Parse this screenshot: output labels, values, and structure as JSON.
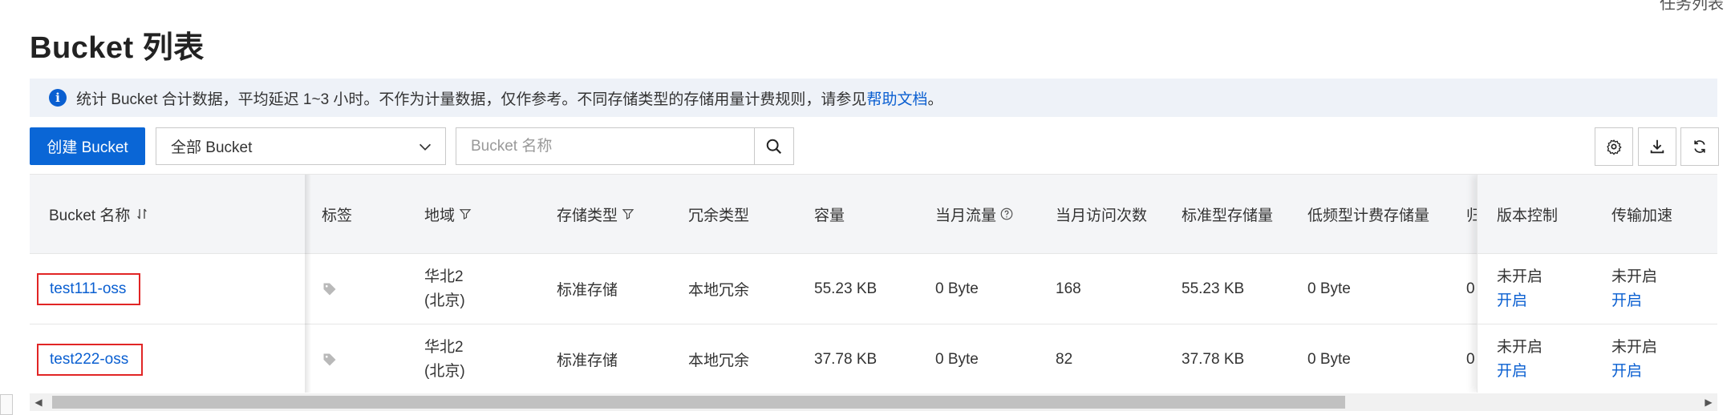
{
  "page": {
    "topright_text": "任务列表",
    "title": "Bucket 列表"
  },
  "notice": {
    "text": "统计 Bucket 合计数据，平均延迟 1~3 小时。不作为计量数据，仅作参考。不同存储类型的存储用量计费规则，请参见",
    "link_text": "帮助文档",
    "suffix": "。"
  },
  "toolbar": {
    "create_label": "创建 Bucket",
    "filter_value": "全部 Bucket",
    "search_placeholder": "Bucket 名称",
    "icons": [
      "gear-icon",
      "download-icon",
      "refresh-icon"
    ]
  },
  "table": {
    "headers": {
      "name": "Bucket 名称",
      "tag": "标签",
      "region": "地域",
      "storage_class": "存储类型",
      "redundancy": "冗余类型",
      "capacity": "容量",
      "monthly_traffic": "当月流量",
      "monthly_requests": "当月访问次数",
      "standard_storage": "标准型存储量",
      "ia_storage": "低频型计费存储量",
      "archive_partial": "归",
      "versioning": "版本控制",
      "acceleration": "传输加速"
    },
    "rows": [
      {
        "name": "test111-oss",
        "region_line1": "华北2",
        "region_line2": "(北京)",
        "storage_class": "标准存储",
        "redundancy": "本地冗余",
        "capacity": "55.23 KB",
        "monthly_traffic": "0 Byte",
        "monthly_requests": "168",
        "standard_storage": "55.23 KB",
        "ia_storage": "0 Byte",
        "archive_partial": "0",
        "versioning_status": "未开启",
        "versioning_action": "开启",
        "acceleration_status": "未开启",
        "acceleration_action": "开启"
      },
      {
        "name": "test222-oss",
        "region_line1": "华北2",
        "region_line2": "(北京)",
        "storage_class": "标准存储",
        "redundancy": "本地冗余",
        "capacity": "37.78 KB",
        "monthly_traffic": "0 Byte",
        "monthly_requests": "82",
        "standard_storage": "37.78 KB",
        "ia_storage": "0 Byte",
        "archive_partial": "0",
        "versioning_status": "未开启",
        "versioning_action": "开启",
        "acceleration_status": "未开启",
        "acceleration_action": "开启"
      }
    ]
  },
  "colors": {
    "primary": "#0a66d6",
    "link": "#0a5fd1",
    "highlight_box": "#e12525",
    "notice_bg": "#eef2f8",
    "header_bg": "#f4f5f7"
  }
}
